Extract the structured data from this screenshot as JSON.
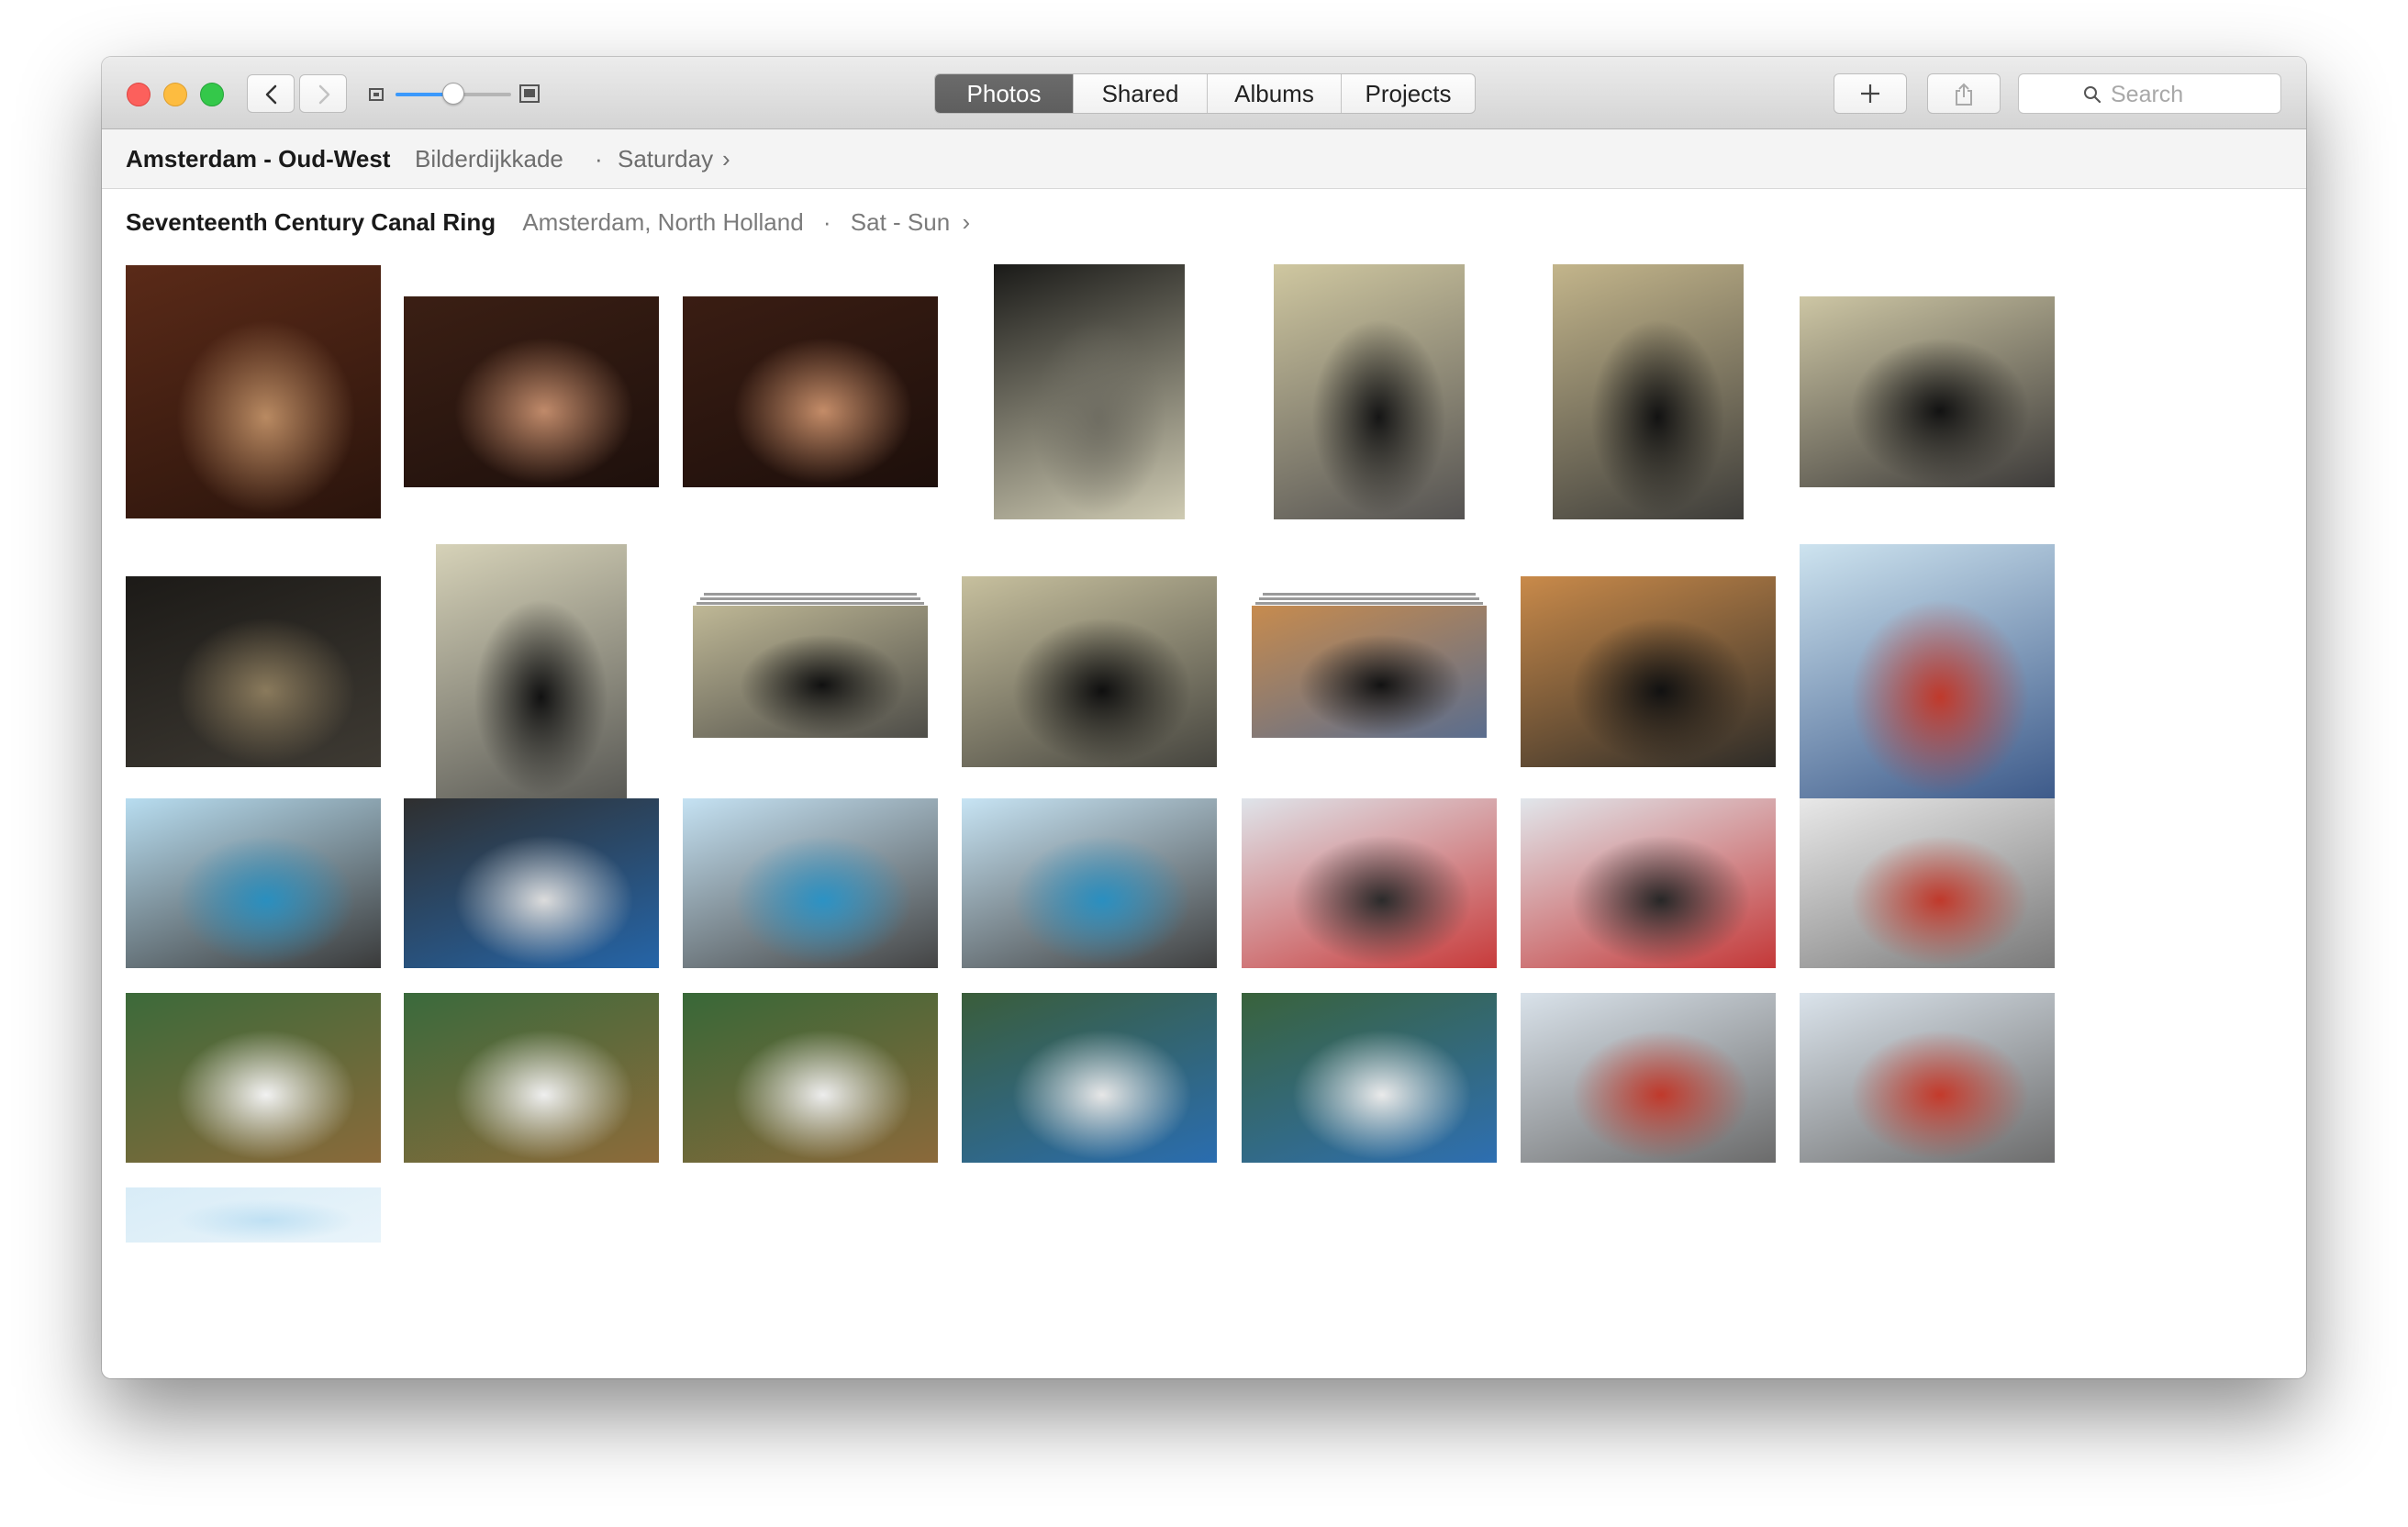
{
  "nav": {
    "segments": [
      {
        "label": "Photos",
        "active": true
      },
      {
        "label": "Shared",
        "active": false
      },
      {
        "label": "Albums",
        "active": false
      },
      {
        "label": "Projects",
        "active": false
      }
    ],
    "zoom_level": 0.5,
    "search_placeholder": "Search"
  },
  "breadcrumb": {
    "place": "Amsterdam - Oud-West",
    "street": "Bilderdijkkade",
    "separator": "·",
    "day": "Saturday",
    "chevron": "›"
  },
  "section": {
    "title": "Seventeenth Century Canal Ring",
    "location": "Amsterdam, North Holland",
    "separator": "·",
    "dates": "Sat - Sun",
    "chevron": "›"
  },
  "photos": [
    {
      "subject": "white cat on bar table",
      "colors": [
        "#5a2a18",
        "#b98a62",
        "#2a140c"
      ]
    },
    {
      "subject": "woman holding white cat in bar",
      "colors": [
        "#3b1f14",
        "#c08a6a",
        "#1e100c"
      ]
    },
    {
      "subject": "woman holding white cat in bar",
      "colors": [
        "#3a1d13",
        "#c48c68",
        "#1d0f0b"
      ]
    },
    {
      "subject": "black cat on stairs",
      "colors": [
        "#1a1a18",
        "#6f6d62",
        "#cfcbb3"
      ]
    },
    {
      "subject": "black cat by wall",
      "colors": [
        "#cfc7a0",
        "#151515",
        "#555352"
      ]
    },
    {
      "subject": "black cat near doorway",
      "colors": [
        "#c3b58b",
        "#121212",
        "#3e3d3a"
      ]
    },
    {
      "subject": "black cat by wall",
      "colors": [
        "#cdc6a4",
        "#121212",
        "#3d3b3a"
      ]
    },
    {
      "subject": "black cat blurred",
      "colors": [
        "#1c1a17",
        "#8a7a5c",
        "#3e3a33"
      ]
    },
    {
      "subject": "black cat on stairs",
      "colors": [
        "#d6d2b8",
        "#111111",
        "#595955"
      ]
    },
    {
      "subject": "black cat on stairs",
      "colors": [
        "#bfb896",
        "#101010",
        "#4e4d48"
      ]
    },
    {
      "subject": "black cat on stairs",
      "colors": [
        "#c7c09e",
        "#0f0f0f",
        "#46453f"
      ]
    },
    {
      "subject": "black cat on wooden table",
      "colors": [
        "#c78b4e",
        "#121212",
        "#5a6d8e"
      ]
    },
    {
      "subject": "black cat on wooden table",
      "colors": [
        "#c98a4a",
        "#111111",
        "#2e2c28"
      ]
    },
    {
      "subject": "waffle stand",
      "colors": [
        "#cde3ef",
        "#c0392b",
        "#3d5a8a"
      ]
    },
    {
      "subject": "food truck with crowd",
      "colors": [
        "#b8ddf0",
        "#2a8fbf",
        "#3a3a3a"
      ]
    },
    {
      "subject": "stall with people",
      "colors": [
        "#2f2f2f",
        "#dcdcdc",
        "#2565a8"
      ]
    },
    {
      "subject": "food truck",
      "colors": [
        "#c5e2f3",
        "#2c92c4",
        "#444444"
      ]
    },
    {
      "subject": "food truck",
      "colors": [
        "#c7e4f4",
        "#2a8fc0",
        "#404040"
      ]
    },
    {
      "subject": "festival crowd",
      "colors": [
        "#dfe4ea",
        "#2b2b2b",
        "#c83b3b"
      ]
    },
    {
      "subject": "festival crowd",
      "colors": [
        "#e1e6eb",
        "#272727",
        "#c43838"
      ]
    },
    {
      "subject": "waffle plates",
      "colors": [
        "#e8e8e8",
        "#c0392b",
        "#7a7a7a"
      ]
    },
    {
      "subject": "stroopwafel cooking",
      "colors": [
        "#3c6a3a",
        "#f2f2f2",
        "#8a6a3a"
      ]
    },
    {
      "subject": "stroopwafel cooking",
      "colors": [
        "#3a6a3c",
        "#efefef",
        "#8d6b3a"
      ]
    },
    {
      "subject": "stroopwafel cooking",
      "colors": [
        "#386838",
        "#ededed",
        "#8b693a"
      ]
    },
    {
      "subject": "stroopwafel serving",
      "colors": [
        "#3a5d3a",
        "#e7e7e7",
        "#2a6db0"
      ]
    },
    {
      "subject": "stroopwafel serving",
      "colors": [
        "#39623b",
        "#eaeaea",
        "#2e6fb2"
      ]
    },
    {
      "subject": "stroopwafel in paper",
      "colors": [
        "#d9e2ea",
        "#c0392b",
        "#6b6b6b"
      ]
    },
    {
      "subject": "stroopwafel in paper",
      "colors": [
        "#dae3eb",
        "#c43a2b",
        "#6d6d6d"
      ]
    },
    {
      "subject": "sky",
      "colors": [
        "#d8ecf7",
        "#bfe0f3",
        "#e9f4fa"
      ]
    }
  ]
}
